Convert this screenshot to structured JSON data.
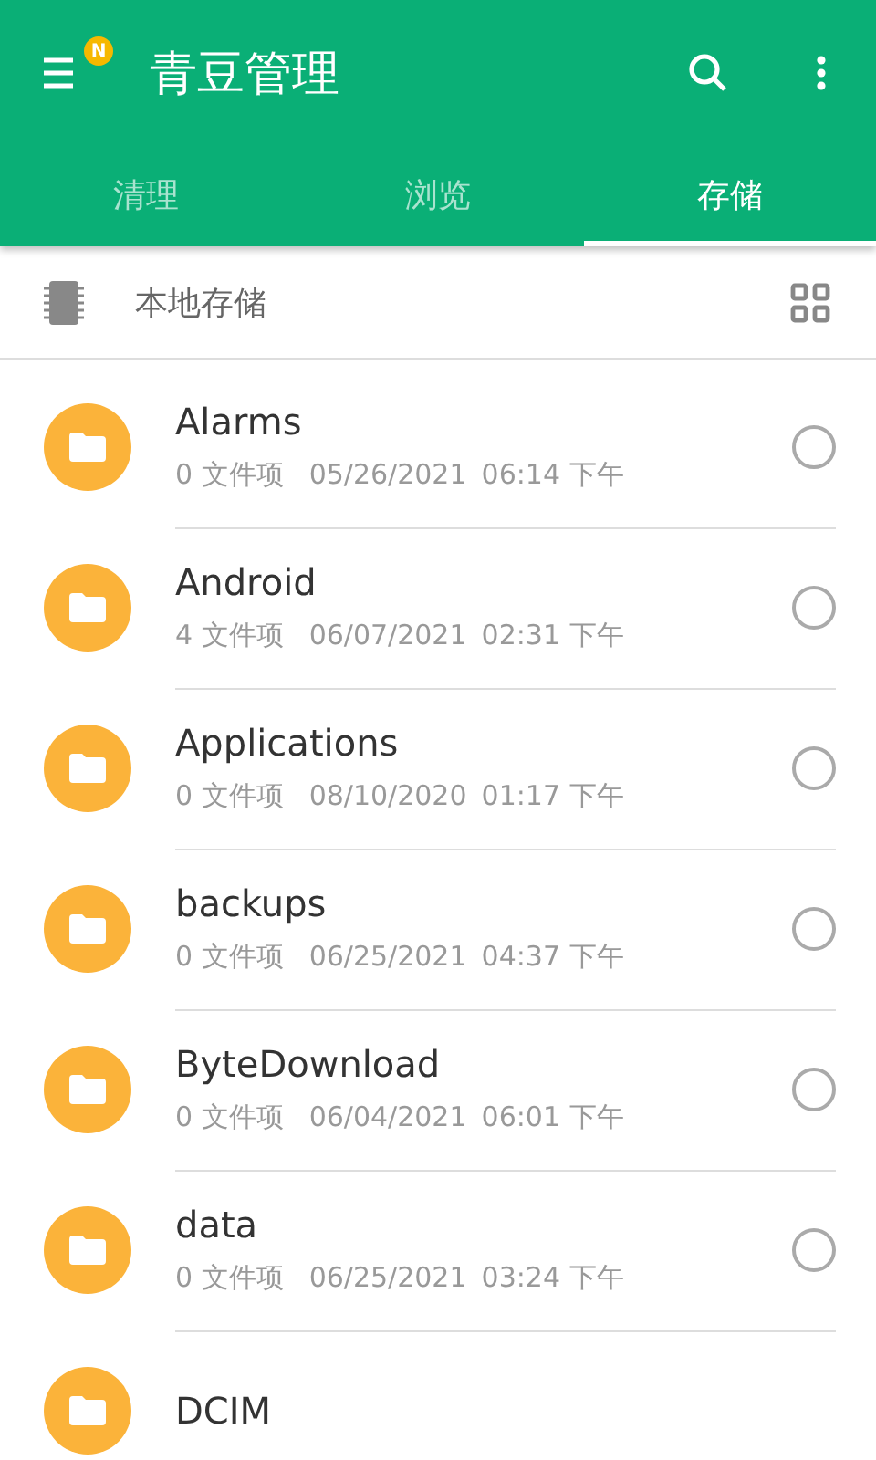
{
  "app_bar": {
    "title": "青豆管理",
    "badge": "N"
  },
  "tabs": [
    {
      "label": "清理",
      "selected": false
    },
    {
      "label": "浏览",
      "selected": false
    },
    {
      "label": "存储",
      "selected": true
    }
  ],
  "location": {
    "label": "本地存储"
  },
  "folders": [
    {
      "name": "Alarms",
      "count": "0 文件项",
      "date": "05/26/2021",
      "time": "06:14 下午",
      "selected": false
    },
    {
      "name": "Android",
      "count": "4 文件项",
      "date": "06/07/2021",
      "time": "02:31 下午",
      "selected": false
    },
    {
      "name": "Applications",
      "count": "0 文件项",
      "date": "08/10/2020",
      "time": "01:17 下午",
      "selected": false
    },
    {
      "name": "backups",
      "count": "0 文件项",
      "date": "06/25/2021",
      "time": "04:37 下午",
      "selected": false
    },
    {
      "name": "ByteDownload",
      "count": "0 文件项",
      "date": "06/04/2021",
      "time": "06:01 下午",
      "selected": false
    },
    {
      "name": "data",
      "count": "0 文件项",
      "date": "06/25/2021",
      "time": "03:24 下午",
      "selected": false
    },
    {
      "name": "DCIM"
    }
  ]
}
